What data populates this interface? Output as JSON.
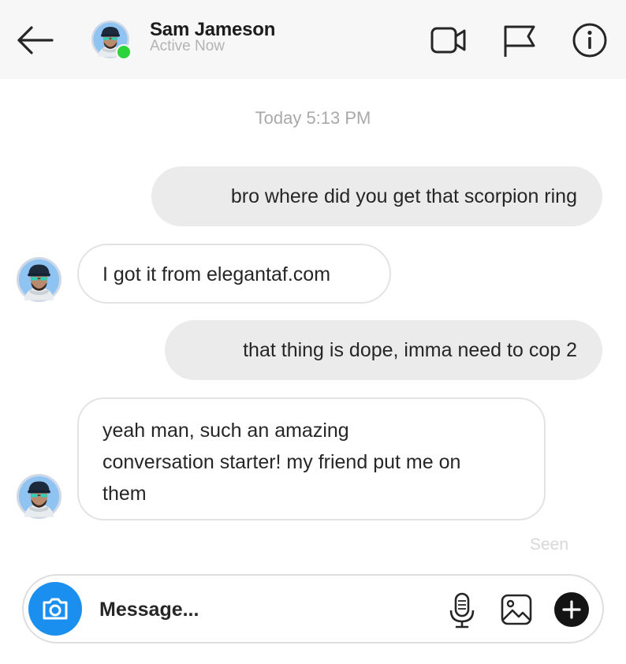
{
  "header": {
    "contact_name": "Sam Jameson",
    "status": "Active Now",
    "icons": [
      "back-arrow-icon",
      "video-camera-icon",
      "flag-icon",
      "info-icon"
    ]
  },
  "conversation": {
    "timestamp": "Today 5:13 PM",
    "messages": [
      {
        "direction": "sent",
        "text": "bro where did you get that scorpion ring"
      },
      {
        "direction": "received",
        "text": "I got it from elegantaf.com"
      },
      {
        "direction": "sent",
        "text": "that thing is dope, imma need to cop 2"
      },
      {
        "direction": "received",
        "lines": [
          "yeah man, such an amazing",
          "conversation starter! my friend put me on",
          "them"
        ]
      }
    ],
    "seen_label": "Seen"
  },
  "composer": {
    "placeholder": "Message...",
    "value": "",
    "icons": [
      "camera-icon",
      "microphone-icon",
      "image-icon",
      "plus-icon"
    ]
  },
  "colors": {
    "online_indicator": "#2bd43a",
    "camera_button": "#1a8ff0",
    "sent_bubble": "#ebebeb",
    "header_bg": "#f7f7f7"
  }
}
